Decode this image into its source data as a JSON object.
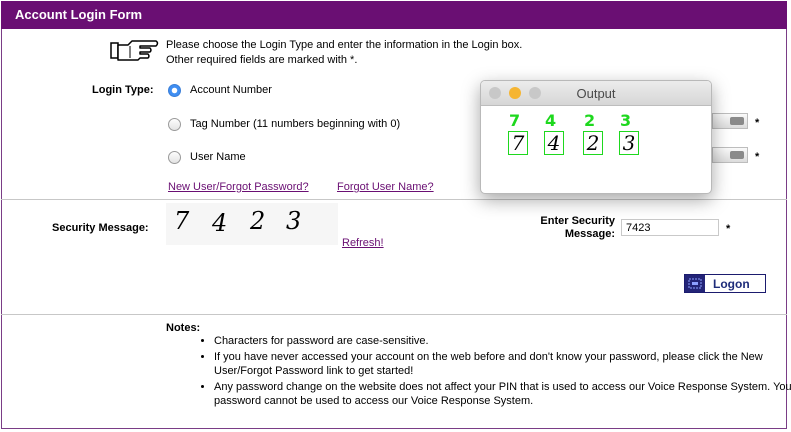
{
  "form": {
    "title": "Account Login Form",
    "instruction_line1": "Please choose the Login Type and enter the information in the Login box.",
    "instruction_line2": "Other required fields are marked with",
    "required_marker": "*",
    "instruction_end": "."
  },
  "login_type": {
    "label": "Login Type:",
    "options": [
      {
        "label": "Account Number",
        "selected": true
      },
      {
        "label": "Tag Number (11 numbers beginning with 0)",
        "selected": false
      },
      {
        "label": "User Name",
        "selected": false
      }
    ],
    "links": {
      "new_user": "New User/Forgot Password?",
      "forgot_user": "Forgot User Name?"
    }
  },
  "security": {
    "label": "Security Message:",
    "captcha": [
      "7",
      "4",
      "2",
      "3"
    ],
    "refresh": "Refresh!",
    "enter_label_line1": "Enter Security",
    "enter_label_line2": "Message:",
    "enter_value": "7423"
  },
  "logon_button": "Logon",
  "notes": {
    "heading": "Notes:",
    "items": [
      "Characters for password are case-sensitive.",
      "If you have never accessed your account on the web before and don't know your password, please click the New User/Forgot Password link to get started!",
      "Any password change on the website does not affect your PIN that is used to access our Voice Response System. Your password cannot be used to access our Voice Response System."
    ]
  },
  "output_window": {
    "title": "Output",
    "detections": [
      {
        "label": "7",
        "char": "7"
      },
      {
        "label": "4",
        "char": "4"
      },
      {
        "label": "2",
        "char": "2"
      },
      {
        "label": "3",
        "char": "3"
      }
    ],
    "traffic_lights": [
      "#c8c8c8",
      "#f5b533",
      "#c8c8c8"
    ],
    "detection_color": "#1ed81e"
  },
  "colors": {
    "title_bar": "#6a0f73",
    "link": "#6a0f73",
    "button_icon": "#232477"
  }
}
